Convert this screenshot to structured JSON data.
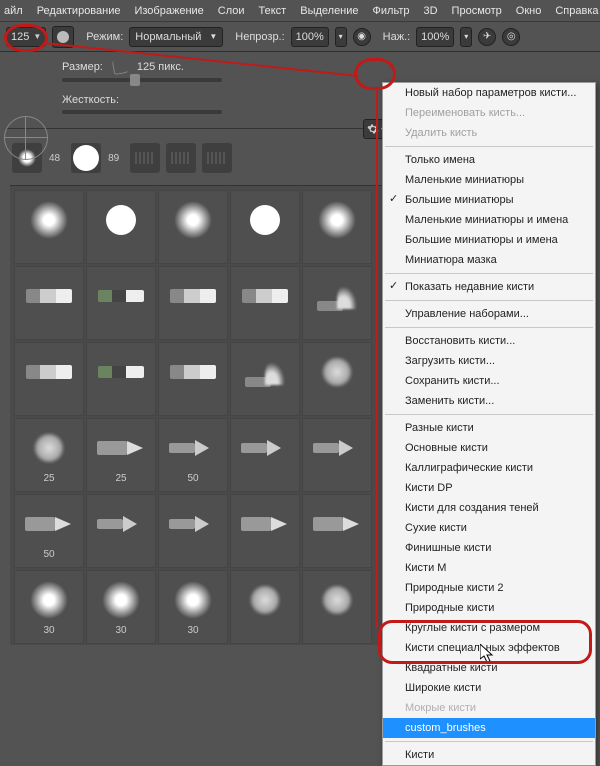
{
  "menubar": [
    "айл",
    "Редактирование",
    "Изображение",
    "Слои",
    "Текст",
    "Выделение",
    "Фильтр",
    "3D",
    "Просмотр",
    "Окно",
    "Справка"
  ],
  "optbar": {
    "size_value": "125",
    "mode_label": "Режим:",
    "mode_value": "Нормальный",
    "opacity_label": "Непрозр.:",
    "opacity_value": "100%",
    "flow_label": "Наж.:",
    "flow_value": "100%"
  },
  "panel": {
    "size_label": "Размер:",
    "size_value": "125 пикс.",
    "hardness_label": "Жесткость:"
  },
  "brush_strip": [
    {
      "label": "48"
    },
    {
      "label": "89"
    },
    {
      "label": ""
    },
    {
      "label": ""
    },
    {
      "label": ""
    }
  ],
  "grid": [
    {
      "shape": "s-round-soft",
      "num": ""
    },
    {
      "shape": "s-round-hard",
      "num": ""
    },
    {
      "shape": "s-round-soft",
      "num": ""
    },
    {
      "shape": "s-round-hard",
      "num": ""
    },
    {
      "shape": "s-round-soft",
      "num": ""
    },
    {
      "shape": "s-flat",
      "num": ""
    },
    {
      "shape": "s-flat2",
      "num": ""
    },
    {
      "shape": "s-flat",
      "num": ""
    },
    {
      "shape": "s-flat",
      "num": ""
    },
    {
      "shape": "s-fan",
      "num": ""
    },
    {
      "shape": "s-flat",
      "num": ""
    },
    {
      "shape": "s-flat2",
      "num": ""
    },
    {
      "shape": "s-flat",
      "num": ""
    },
    {
      "shape": "s-fan",
      "num": ""
    },
    {
      "shape": "s-blob",
      "num": ""
    },
    {
      "shape": "s-blob",
      "num": "25"
    },
    {
      "shape": "s-pencil",
      "num": "25"
    },
    {
      "shape": "s-airbrush",
      "num": "50"
    },
    {
      "shape": "s-airbrush",
      "num": ""
    },
    {
      "shape": "s-airbrush",
      "num": ""
    },
    {
      "shape": "s-pencil",
      "num": "50"
    },
    {
      "shape": "s-airbrush",
      "num": ""
    },
    {
      "shape": "s-airbrush",
      "num": ""
    },
    {
      "shape": "s-pencil",
      "num": ""
    },
    {
      "shape": "s-pencil",
      "num": ""
    },
    {
      "shape": "s-round-soft",
      "num": "30"
    },
    {
      "shape": "s-round-soft",
      "num": "30"
    },
    {
      "shape": "s-round-soft",
      "num": "30"
    },
    {
      "shape": "s-blob",
      "num": ""
    },
    {
      "shape": "s-blob",
      "num": ""
    },
    {
      "shape": "s-spark",
      "num": ""
    },
    {
      "shape": "s-scatter",
      "num": ""
    },
    {
      "shape": "s-scatter",
      "num": ""
    },
    {
      "shape": "s-spark",
      "num": ""
    },
    {
      "shape": "s-scatter",
      "num": ""
    }
  ],
  "ctx": {
    "group1": [
      "Новый набор параметров кисти..."
    ],
    "group1_disabled": [
      "Переименовать кисть...",
      "Удалить кисть"
    ],
    "group2": [
      {
        "label": "Только имена",
        "checked": false
      },
      {
        "label": "Маленькие миниатюры",
        "checked": false
      },
      {
        "label": "Большие миниатюры",
        "checked": true
      },
      {
        "label": "Маленькие миниатюры и имена",
        "checked": false
      },
      {
        "label": "Большие миниатюры и имена",
        "checked": false
      },
      {
        "label": "Миниатюра мазка",
        "checked": false
      }
    ],
    "group3": [
      {
        "label": "Показать недавние кисти",
        "checked": true
      }
    ],
    "group4": [
      "Управление наборами..."
    ],
    "group5": [
      "Восстановить кисти...",
      "Загрузить кисти...",
      "Сохранить кисти...",
      "Заменить кисти..."
    ],
    "group6": [
      "Разные кисти",
      "Основные кисти",
      "Каллиграфические кисти",
      "Кисти DP",
      "Кисти для создания теней",
      "Сухие кисти",
      "Финишные кисти",
      "Кисти M",
      "Природные кисти 2",
      "Природные кисти",
      "Круглые кисти с размером",
      "Кисти специальных эффектов",
      "Квадратные кисти",
      "Широкие кисти"
    ],
    "group6_faded": "Мокрые кисти",
    "group7_selected": "custom_brushes",
    "group8": [
      "Кисти"
    ]
  }
}
